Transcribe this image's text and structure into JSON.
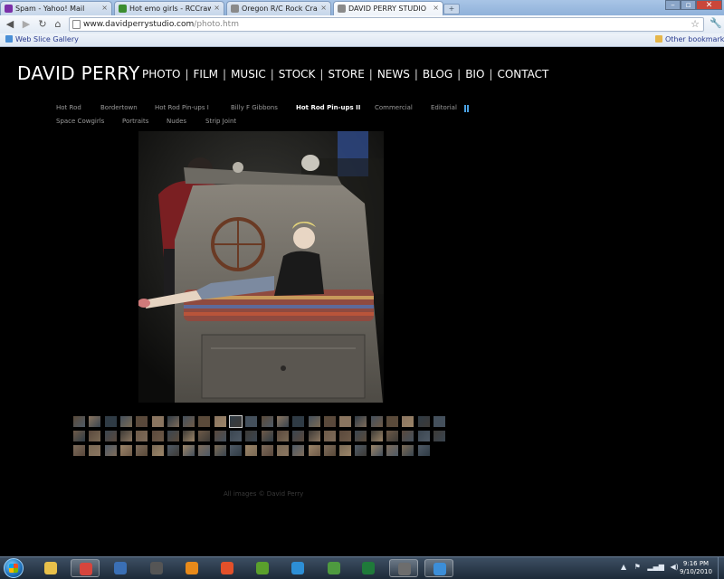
{
  "browser": {
    "tabs": [
      {
        "title": "Spam - Yahoo! Mail",
        "icon": "yahoo-mail-icon",
        "color": "#7b2fa8",
        "active": false
      },
      {
        "title": "Hot emo girls - RCCrawle...",
        "icon": "rccrawler-icon",
        "color": "#3c8d2f",
        "active": false
      },
      {
        "title": "Oregon R/C Rock Crawle...",
        "icon": "page-icon",
        "color": "#8a8a8a",
        "active": false
      },
      {
        "title": "DAVID PERRY STUDIO",
        "icon": "page-icon",
        "color": "#8a8a8a",
        "active": true
      }
    ],
    "url_host": "www.davidperrystudio.com",
    "url_path": "/photo.htm",
    "bookmarks": {
      "left_label": "Web Slice Gallery",
      "right_label": "Other bookmarks"
    }
  },
  "site": {
    "brand": "DAVID PERRY",
    "main_nav": [
      "PHOTO",
      "FILM",
      "MUSIC",
      "STOCK",
      "STORE",
      "NEWS",
      "BLOG",
      "BIO",
      "CONTACT"
    ],
    "sub_nav": [
      {
        "label": "Hot Rod",
        "active": false
      },
      {
        "label": "Bordertown",
        "active": false
      },
      {
        "label": "Hot Rod Pin-ups I",
        "active": false
      },
      {
        "label": "Billy F Gibbons",
        "active": false
      },
      {
        "label": "Hot Rod Pin-ups II",
        "active": true
      },
      {
        "label": "Commercial",
        "active": false
      },
      {
        "label": "Editorial",
        "active": false
      },
      {
        "label": "Space Cowgirls",
        "active": false
      },
      {
        "label": "Portraits",
        "active": false
      },
      {
        "label": "Nudes",
        "active": false
      },
      {
        "label": "Strip Joint",
        "active": false
      }
    ],
    "thumbnails": {
      "rows": 3,
      "counts": [
        24,
        24,
        23
      ],
      "selected_row": 0,
      "selected_index": 10
    },
    "footer": "All images © David Perry"
  },
  "taskbar": {
    "apps": [
      {
        "icon": "explorer-folder-icon",
        "color": "#e8c04a",
        "open": false
      },
      {
        "icon": "chrome-icon",
        "color": "#d6453d",
        "open": true
      },
      {
        "icon": "network-computer-icon",
        "color": "#3a6fb5",
        "open": false
      },
      {
        "icon": "alien-mask-icon",
        "color": "#555555",
        "open": false
      },
      {
        "icon": "media-player-icon",
        "color": "#e88a1a",
        "open": false
      },
      {
        "icon": "swirl-app-icon",
        "color": "#e2502a",
        "open": false
      },
      {
        "icon": "utorrent-icon",
        "color": "#5aa02c",
        "open": false
      },
      {
        "icon": "people-icon",
        "color": "#2d8fd6",
        "open": false
      },
      {
        "icon": "monitor-app-icon",
        "color": "#4e9a3f",
        "open": false
      },
      {
        "icon": "excel-icon",
        "color": "#1f7a3a",
        "open": false
      },
      {
        "icon": "camera-icon",
        "color": "#6d6d6d",
        "open": true
      },
      {
        "icon": "ie-icon",
        "color": "#3c8ed8",
        "open": true
      }
    ],
    "time": "9:16 PM",
    "date": "9/10/2010"
  }
}
